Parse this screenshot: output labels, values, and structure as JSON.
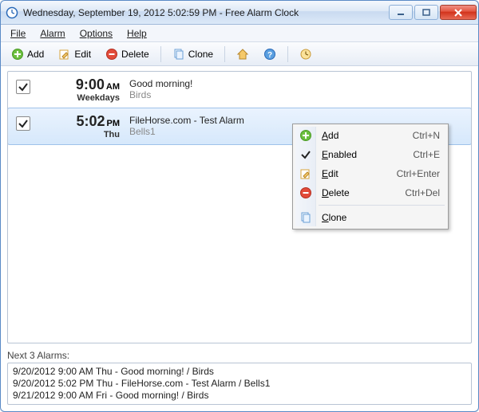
{
  "title": "Wednesday, September 19, 2012 5:02:59 PM - Free Alarm Clock",
  "menubar": {
    "file": "File",
    "alarm": "Alarm",
    "options": "Options",
    "help": "Help"
  },
  "toolbar": {
    "add": "Add",
    "edit": "Edit",
    "delete": "Delete",
    "clone": "Clone"
  },
  "alarms": [
    {
      "enabled": true,
      "time": "9:00",
      "ampm": "AM",
      "days": "Weekdays",
      "title": "Good morning!",
      "sound": "Birds",
      "selected": false
    },
    {
      "enabled": true,
      "time": "5:02",
      "ampm": "PM",
      "days": "Thu",
      "title": "FileHorse.com - Test Alarm",
      "sound": "Bells1",
      "selected": true
    }
  ],
  "context_menu": [
    {
      "icon": "add",
      "label": "Add",
      "shortcut": "Ctrl+N",
      "underline": 0
    },
    {
      "icon": "check",
      "label": "Enabled",
      "shortcut": "Ctrl+E",
      "underline": 0
    },
    {
      "icon": "edit",
      "label": "Edit",
      "shortcut": "Ctrl+Enter",
      "underline": 0
    },
    {
      "icon": "delete",
      "label": "Delete",
      "shortcut": "Ctrl+Del",
      "underline": 0
    },
    {
      "sep": true
    },
    {
      "icon": "clone",
      "label": "Clone",
      "shortcut": "",
      "underline": 0
    }
  ],
  "next": {
    "label": "Next 3 Alarms:",
    "items": [
      "9/20/2012 9:00 AM Thu - Good morning! / Birds",
      "9/20/2012 5:02 PM Thu - FileHorse.com - Test Alarm / Bells1",
      "9/21/2012 9:00 AM Fri - Good morning! / Birds"
    ]
  }
}
